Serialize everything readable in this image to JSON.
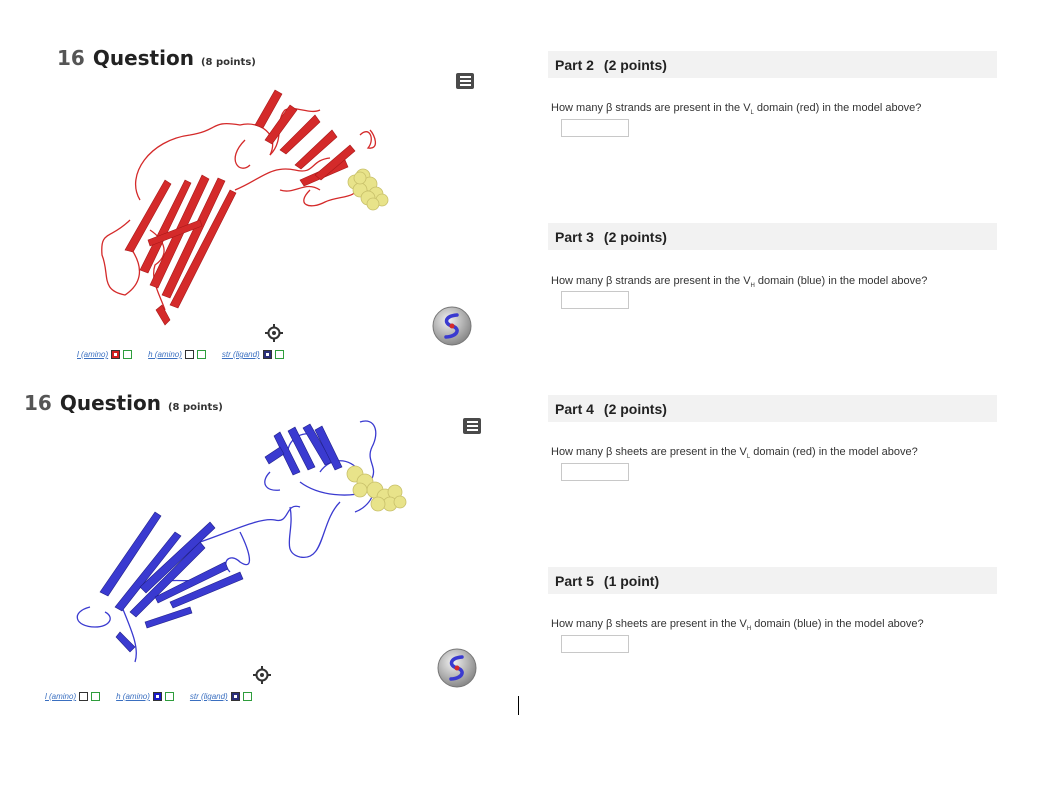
{
  "questions": [
    {
      "number": "16",
      "word": "Question",
      "points": "(8 points)"
    },
    {
      "number": "16",
      "word": "Question",
      "points": "(8 points)"
    }
  ],
  "viewer1": {
    "controls": [
      {
        "label": "l (amino)",
        "swatch": "#d21f1f"
      },
      {
        "label": "h (amino)",
        "swatch": "#ffffff"
      },
      {
        "label": "str (ligand)",
        "swatch": "#2c2f7a"
      }
    ]
  },
  "viewer2": {
    "controls": [
      {
        "label": "l (amino)",
        "swatch": "#ffffff"
      },
      {
        "label": "h (amino)",
        "swatch": "#1a1ac8"
      },
      {
        "label": "str (ligand)",
        "swatch": "#2c2f7a"
      }
    ]
  },
  "parts": [
    {
      "title": "Part 2",
      "points": "(2 points)",
      "q_pre": "How many β strands are present in the V",
      "q_sub": "L",
      "q_post": " domain (red) in the model above?",
      "answer": ""
    },
    {
      "title": "Part 3",
      "points": "(2 points)",
      "q_pre": "How many β strands are present in the V",
      "q_sub": "H",
      "q_post": " domain (blue) in the model above?",
      "answer": ""
    },
    {
      "title": "Part 4",
      "points": "(2 points)",
      "q_pre": "How many β sheets are present in the V",
      "q_sub": "L",
      "q_post": " domain (red) in the model above?",
      "answer": ""
    },
    {
      "title": "Part 5",
      "points": "(1 point)",
      "q_pre": "How many β sheets are present in the V",
      "q_sub": "H",
      "q_post": " domain (blue) in the model above?",
      "answer": ""
    }
  ],
  "colors": {
    "light_chain": "#d42a2a",
    "heavy_chain": "#3a3ad0",
    "ligand": "#e8e38a",
    "panel_bg": "#f2f2f2"
  }
}
